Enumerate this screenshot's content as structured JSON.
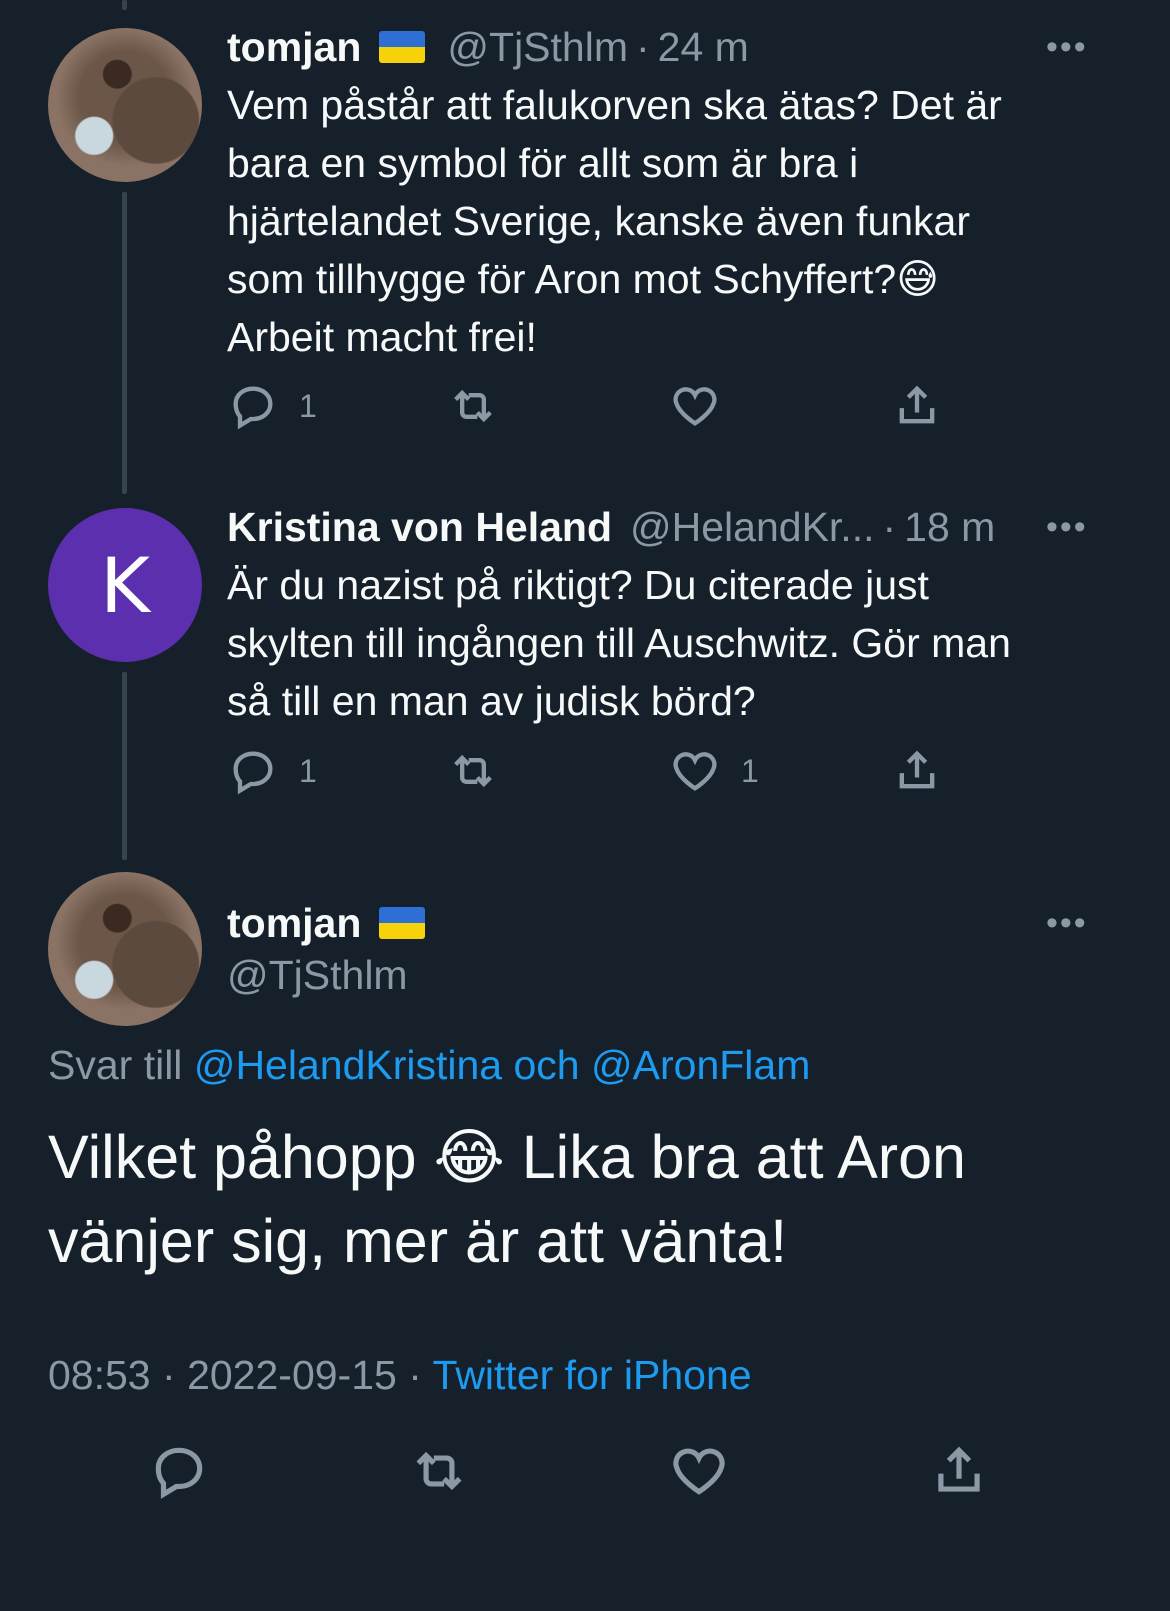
{
  "colors": {
    "background": "#15202b",
    "text": "#f7f9f9",
    "muted": "#8b98a5",
    "link": "#1d9bf0",
    "avatar_k": "#5b2fad"
  },
  "tweet1": {
    "name": "tomjan",
    "handle": "@TjSthlm",
    "dot": "·",
    "time": "24 m",
    "more": "•••",
    "text_lines": [
      "Vem påstår att falukorven ska ätas? Det är",
      "bara en symbol för allt som är bra i",
      "hjärtelandet Sverige, kanske även funkar",
      "som tillhygge för Aron mot Schyffert?😅",
      "Arbeit macht frei!"
    ],
    "reply_count": "1",
    "like_count": ""
  },
  "tweet2": {
    "avatar_letter": "K",
    "name": "Kristina von Heland",
    "handle": "@HelandKr...",
    "dot": "·",
    "time": "18 m",
    "more": "•••",
    "text_lines": [
      "Är du nazist på riktigt? Du citerade just",
      "skylten till ingången till Auschwitz. Gör man",
      "så till en man av judisk börd?"
    ],
    "reply_count": "1",
    "like_count": "1"
  },
  "main_tweet": {
    "name": "tomjan",
    "handle": "@TjSthlm",
    "more": "•••",
    "reply_prefix": "Svar till",
    "reply_user1": "@HelandKristina",
    "reply_and": "och",
    "reply_user2": "@AronFlam",
    "text_lines": [
      "Vilket påhopp 😂 Lika bra att Aron",
      "vänjer sig, mer är att vänta!"
    ],
    "time": "08:53",
    "dot": "·",
    "date": "2022-09-15",
    "source": "Twitter for iPhone"
  },
  "icons": [
    "reply-icon",
    "retweet-icon",
    "like-icon",
    "share-icon",
    "flag-ukraine-icon",
    "more-icon"
  ]
}
